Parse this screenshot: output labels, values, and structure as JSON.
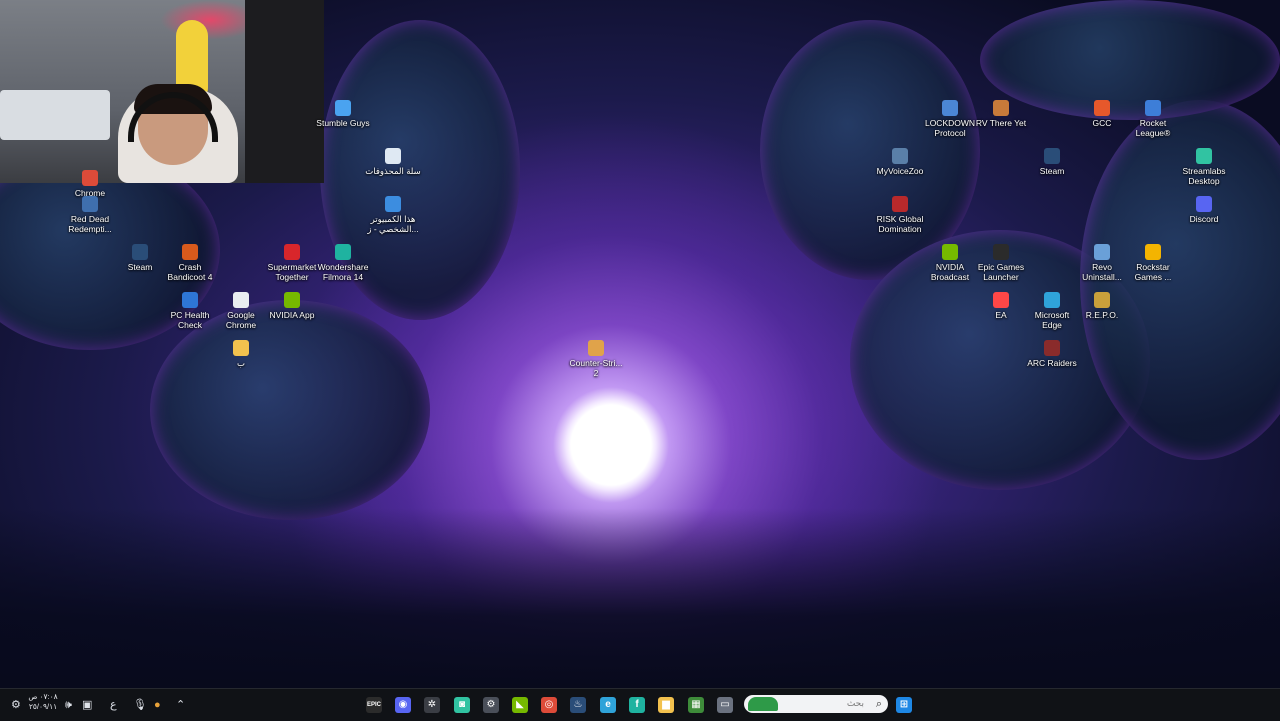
{
  "desktop_icons": [
    {
      "label": "Stumble Guys",
      "icon": "stumble-guys-icon",
      "color": "#4aa3f0"
    },
    {
      "label": "سلة المحذوفات",
      "icon": "recycle-bin-icon",
      "color": "#dfe9f3"
    },
    {
      "label": "هذا الكمبيوتر الشخصي - ز...",
      "icon": "this-pc-icon",
      "color": "#3c8de0"
    },
    {
      "label": "Chrome",
      "icon": "chrome-shortcut-icon",
      "color": "#dd4b39"
    },
    {
      "label": "Red Dead Redempti...",
      "icon": "red-dead-redemption-icon",
      "color": "#3f6fae"
    },
    {
      "label": "Steam",
      "icon": "steam-icon",
      "color": "#2a4d78"
    },
    {
      "label": "Crash Bandicoot 4",
      "icon": "crash-bandicoot-icon",
      "color": "#d85a1c"
    },
    {
      "label": "Supermarket Together",
      "icon": "supermarket-together-icon",
      "color": "#d8262b"
    },
    {
      "label": "Wondershare Filmora 14",
      "icon": "filmora-icon",
      "color": "#1fb3a0"
    },
    {
      "label": "PC Health Check",
      "icon": "pc-health-check-icon",
      "color": "#2e76d6"
    },
    {
      "label": "Google Chrome",
      "icon": "google-chrome-icon",
      "color": "#e9edf1"
    },
    {
      "label": "NVIDIA App",
      "icon": "nvidia-app-icon",
      "color": "#76b900"
    },
    {
      "label": "ب",
      "icon": "folder-icon",
      "color": "#f2c14e"
    },
    {
      "label": "Counter-Stri... 2",
      "icon": "counter-strike-2-icon",
      "color": "#e0a34a"
    },
    {
      "label": "MyVoiceZoo",
      "icon": "myvoicezoo-icon",
      "color": "#5a7fa8"
    },
    {
      "label": "RISK Global Domination",
      "icon": "risk-global-domination-icon",
      "color": "#b8292b"
    },
    {
      "label": "LOCKDOWN Protocol",
      "icon": "lockdown-protocol-icon",
      "color": "#4b86d4"
    },
    {
      "label": "RV There Yet",
      "icon": "rv-there-yet-icon",
      "color": "#c77a3a"
    },
    {
      "label": "GCC",
      "icon": "gcc-icon",
      "color": "#e6582b"
    },
    {
      "label": "Rocket League®",
      "icon": "rocket-league-icon",
      "color": "#3d7ed8"
    },
    {
      "label": "Steam",
      "icon": "steam-icon",
      "color": "#2a4d78"
    },
    {
      "label": "Streamlabs Desktop",
      "icon": "streamlabs-icon",
      "color": "#31c3a2"
    },
    {
      "label": "Discord",
      "icon": "discord-icon",
      "color": "#5865f2"
    },
    {
      "label": "NVIDIA Broadcast",
      "icon": "nvidia-broadcast-icon",
      "color": "#76b900"
    },
    {
      "label": "Epic Games Launcher",
      "icon": "epic-games-icon",
      "color": "#2b2b2b"
    },
    {
      "label": "Revo Uninstall...",
      "icon": "revo-uninstaller-icon",
      "color": "#6aa0d8"
    },
    {
      "label": "Rockstar Games ...",
      "icon": "rockstar-games-icon",
      "color": "#f4b400"
    },
    {
      "label": "EA",
      "icon": "ea-icon",
      "color": "#ff4747"
    },
    {
      "label": "Microsoft Edge",
      "icon": "edge-icon",
      "color": "#2fa3d9"
    },
    {
      "label": "R.E.P.O.",
      "icon": "repo-icon",
      "color": "#c9a03b"
    },
    {
      "label": "ARC Raiders",
      "icon": "arc-raiders-icon",
      "color": "#8a2b2b"
    }
  ],
  "taskbar": {
    "clock_time": "٠٧:٠٨ ص",
    "clock_date": "٢٥/٠٩/١١",
    "language": "ع",
    "search_placeholder": "بحث",
    "pinned": [
      {
        "icon": "epic-games-icon",
        "glyph": "EPIC",
        "color": "#2b2b2b"
      },
      {
        "icon": "discord-icon",
        "glyph": "◉",
        "color": "#5865f2"
      },
      {
        "icon": "steelseries-icon",
        "glyph": "✲",
        "color": "#3a3d44"
      },
      {
        "icon": "streamlabs-icon",
        "glyph": "◙",
        "color": "#31c3a2"
      },
      {
        "icon": "settings-gear-icon",
        "glyph": "⚙",
        "color": "#4a4f59"
      },
      {
        "icon": "nvidia-icon",
        "glyph": "◣",
        "color": "#76b900"
      },
      {
        "icon": "chrome-icon",
        "glyph": "◎",
        "color": "#dd4b39"
      },
      {
        "icon": "steam-icon",
        "glyph": "♨",
        "color": "#2a4d78"
      },
      {
        "icon": "edge-icon",
        "glyph": "e",
        "color": "#2fa3d9"
      },
      {
        "icon": "filmora-icon",
        "glyph": "f",
        "color": "#1fb3a0"
      },
      {
        "icon": "file-explorer-icon",
        "glyph": "▆",
        "color": "#f2c14e"
      },
      {
        "icon": "minecraft-icon",
        "glyph": "▦",
        "color": "#3e8c3a"
      },
      {
        "icon": "task-view-icon",
        "glyph": "▭",
        "color": "#6b7280"
      }
    ],
    "start_icon": "windows-start-icon"
  }
}
